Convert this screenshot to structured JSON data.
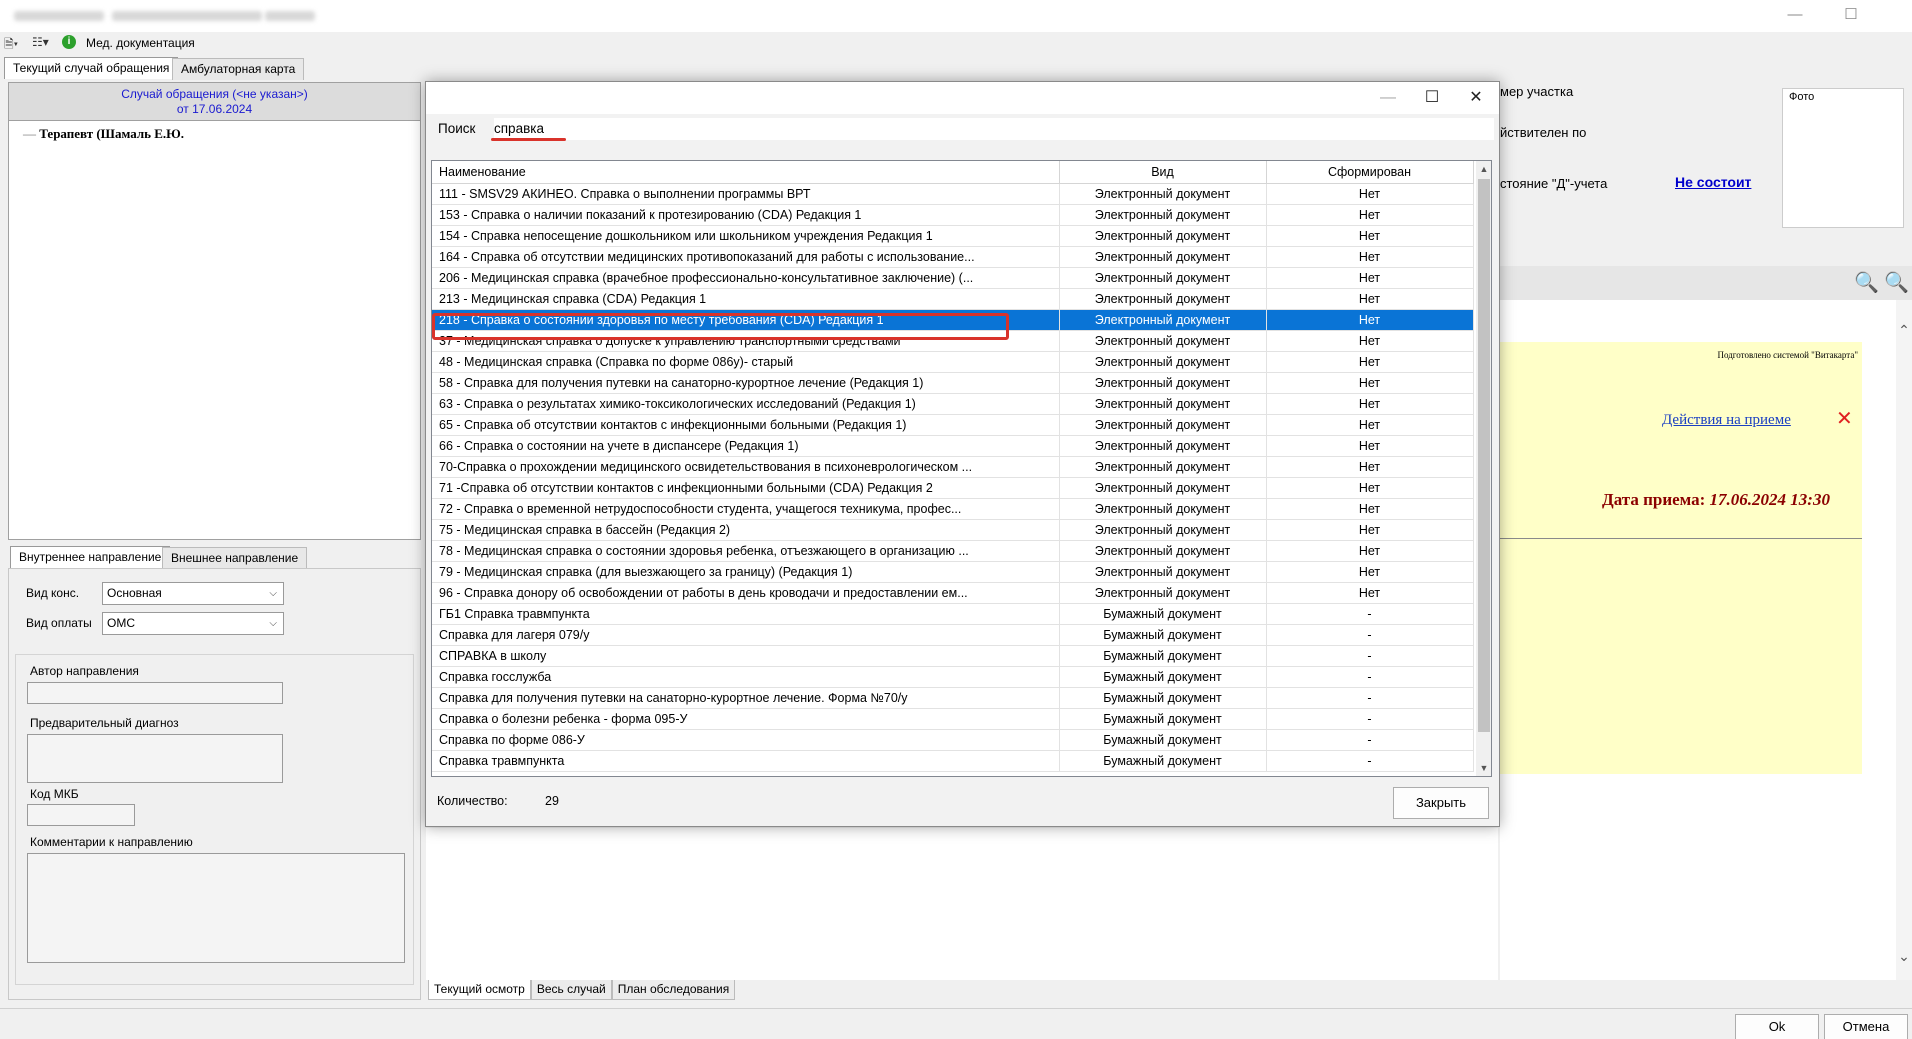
{
  "window": {
    "minimize": "—",
    "maximize": "☐"
  },
  "toolbar": {
    "med_docs": "Мед. документация"
  },
  "main_tabs": [
    "Текущий случай обращения",
    "Амбулаторная карта"
  ],
  "case": {
    "title": "Случай обращения (<не указан>)",
    "date": "от 17.06.2024",
    "tree_item": "Терапевт (Шамаль Е.Ю."
  },
  "referral_tabs": [
    "Внутреннее направление",
    "Внешнее направление"
  ],
  "referral": {
    "vid_kons_label": "Вид конс.",
    "vid_kons_value": "Основная",
    "vid_oplaty_label": "Вид оплаты",
    "vid_oplaty_value": "ОМС",
    "author_label": "Автор направления",
    "diag_label": "Предварительный диагноз",
    "mkb_label": "Код МКБ",
    "comment_label": "Комментарии к направлению"
  },
  "right_panel": {
    "uchastok": "мер участка",
    "deistvitelen": "йствителен по",
    "d_uchet": "стояние \"Д\"-учета",
    "ne_sostoit": "Не состоит",
    "photo": "Фото",
    "prepared_by": "Подготовлено системой \"Витакарта\"",
    "actions_link": "Действия на приеме",
    "date_label": "Дата приема:",
    "date_value": "17.06.2024 13:30"
  },
  "bottom_tabs": [
    "Текущий осмотр",
    "Весь случай",
    "План обследования"
  ],
  "footer": {
    "ok": "Ok",
    "cancel": "Отмена"
  },
  "dialog": {
    "search_label": "Поиск",
    "search_value": "справка",
    "columns": [
      "Наименование",
      "Вид",
      "Сформирован"
    ],
    "count_label": "Количество:",
    "count_value": "29",
    "close_button": "Закрыть",
    "selected_index": 6,
    "rows": [
      [
        "111 - SMSV29 АКИНЕО. Справка о выполнении программы ВРТ",
        "Электронный документ",
        "Нет"
      ],
      [
        "153 - Справка о наличии показаний к протезированию (CDA) Редакция 1",
        "Электронный документ",
        "Нет"
      ],
      [
        "154 - Справка непосещение дошкольником или школьником учреждения Редакция 1",
        "Электронный документ",
        "Нет"
      ],
      [
        "164 - Справка об отсутствии медицинских противопоказаний для работы с использование...",
        "Электронный документ",
        "Нет"
      ],
      [
        "206 - Медицинская справка (врачебное профессионально-консультативное заключение) (...",
        "Электронный документ",
        "Нет"
      ],
      [
        "213 - Медицинская справка (CDA) Редакция 1",
        "Электронный документ",
        "Нет"
      ],
      [
        "218 - Справка о состоянии здоровья по месту требования (CDA) Редакция 1",
        "Электронный документ",
        "Нет"
      ],
      [
        "37 - Медицинская справка о допуске к управлению транспортными средствами",
        "Электронный документ",
        "Нет"
      ],
      [
        "48 - Медицинская справка (Справка по форме 086у)- старый",
        "Электронный документ",
        "Нет"
      ],
      [
        "58 - Справка для получения путевки на санаторно-курортное лечение (Редакция 1)",
        "Электронный документ",
        "Нет"
      ],
      [
        "63 - Справка о результатах химико-токсикологических исследований (Редакция 1)",
        "Электронный документ",
        "Нет"
      ],
      [
        "65 - Справка об отсутствии контактов с инфекционными больными (Редакция 1)",
        "Электронный документ",
        "Нет"
      ],
      [
        "66 - Справка о состоянии на учете в диспансере (Редакция 1)",
        "Электронный документ",
        "Нет"
      ],
      [
        "70-Справка о прохождении медицинского освидетельствования в психоневрологическом ...",
        "Электронный документ",
        "Нет"
      ],
      [
        "71 -Справка об отсутствии контактов с инфекционными больными (CDA) Редакция 2",
        "Электронный документ",
        "Нет"
      ],
      [
        "72 - Справка о временной нетрудоспособности студента, учащегося техникума, профес...",
        "Электронный документ",
        "Нет"
      ],
      [
        "75 - Медицинская справка в бассейн (Редакция 2)",
        "Электронный документ",
        "Нет"
      ],
      [
        "78 - Медицинская справка о состоянии здоровья ребенка, отъезжающего в организацию ...",
        "Электронный документ",
        "Нет"
      ],
      [
        "79 - Медицинская справка (для выезжающего за границу) (Редакция 1)",
        "Электронный документ",
        "Нет"
      ],
      [
        "96 - Справка донору об освобождении от работы в день кроводачи и предоставлении ем...",
        "Электронный документ",
        "Нет"
      ],
      [
        "ГБ1 Справка травмпункта",
        "Бумажный документ",
        "-"
      ],
      [
        "Справка  для лагеря 079/у",
        "Бумажный документ",
        "-"
      ],
      [
        "СПРАВКА в школу",
        "Бумажный документ",
        "-"
      ],
      [
        "Справка госслужба",
        "Бумажный документ",
        "-"
      ],
      [
        "Справка для получения путевки на санаторно-курортное лечение. Форма №70/у",
        "Бумажный документ",
        "-"
      ],
      [
        "Справка о болезни ребенка - форма 095-У",
        "Бумажный документ",
        "-"
      ],
      [
        "Справка по форме 086-У",
        "Бумажный документ",
        "-"
      ],
      [
        "Справка травмпункта",
        "Бумажный документ",
        "-"
      ]
    ]
  },
  "colors": {
    "selection": "#0a74d6",
    "highlight_box": "#d9332b",
    "link": "#0000cc",
    "date_red": "#8b0000"
  }
}
